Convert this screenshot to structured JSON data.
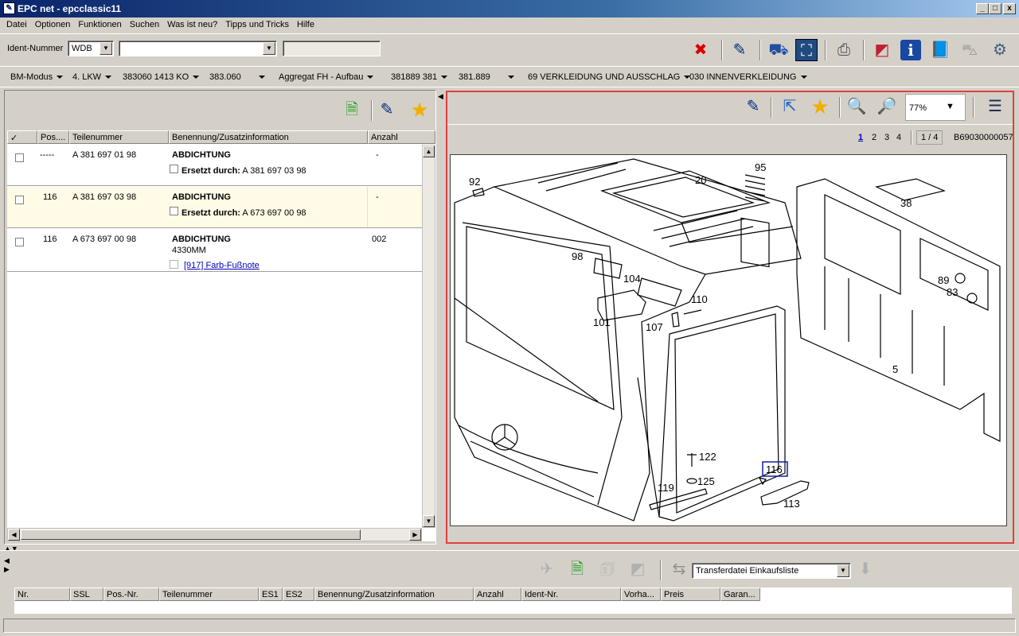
{
  "window": {
    "title": "EPC net - epcclassic11",
    "min": "_",
    "max": "□",
    "close": "x"
  },
  "menu": [
    "Datei",
    "Optionen",
    "Funktionen",
    "Suchen",
    "Was ist neu?",
    "Tipps und Tricks",
    "Hilfe"
  ],
  "ident": {
    "label": "Ident-Nummer",
    "prefix": "WDB",
    "number": "",
    "extra": ""
  },
  "nav": [
    "BM-Modus",
    "4. LKW",
    "383060 1413 KO",
    "383.060",
    "Aggregat FH - Aufbau",
    "381889 381",
    "381.889",
    "69 VERKLEIDUNG UND AUSSCHLAG",
    "030 INNENVERKLEIDUNG"
  ],
  "parts_table": {
    "headers": [
      "✓",
      "Pos....",
      "Teilenummer",
      "Benennung/Zusatzinformation",
      "Anzahl"
    ],
    "rows": [
      {
        "pos": "-----",
        "part": "A 381 697 01 98",
        "name": "ABDICHTUNG",
        "sub_label": "Ersetzt durch:",
        "sub_value": "A 381 697 03 98",
        "qty": "-"
      },
      {
        "pos": "116",
        "part": "A 381 697 03 98",
        "name": "ABDICHTUNG",
        "sub_label": "Ersetzt durch:",
        "sub_value": "A 673 697 00 98",
        "qty": "-"
      },
      {
        "pos": "116",
        "part": "A 673 697 00 98",
        "name": "ABDICHTUNG",
        "info": "4330MM",
        "footnote": "[917] Farb-Fußnote",
        "qty": "002"
      }
    ]
  },
  "viewer": {
    "zoom": "77%",
    "pages": [
      "1",
      "2",
      "3",
      "4"
    ],
    "page_indicator": "1 / 4",
    "image_id": "B69030000057",
    "callouts": [
      "92",
      "20",
      "95",
      "38",
      "98",
      "104",
      "110",
      "101",
      "107",
      "89",
      "83",
      "5",
      "122",
      "125",
      "119",
      "116",
      "113"
    ]
  },
  "cart": {
    "transfer_select": "Transferdatei Einkaufsliste",
    "headers": [
      "Nr.",
      "SSL",
      "Pos.-Nr.",
      "Teilenummer",
      "ES1",
      "ES2",
      "Benennung/Zusatzinformation",
      "Anzahl",
      "Ident-Nr.",
      "Vorha...",
      "Preis",
      "Garan..."
    ]
  },
  "colors": {
    "title_start": "#0a246a",
    "title_end": "#a6caf0",
    "highlight_row": "#fffbe6",
    "viewer_border": "#e04040",
    "link": "#0000c0"
  }
}
